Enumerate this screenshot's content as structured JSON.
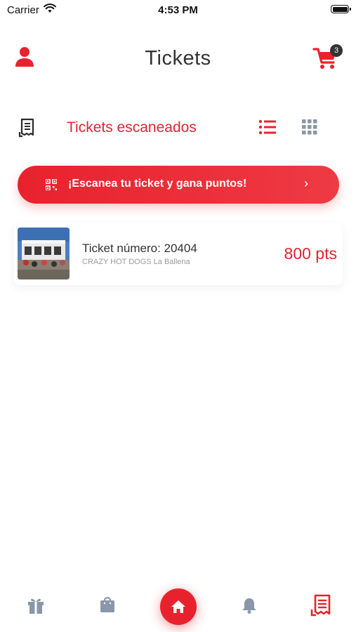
{
  "status_bar": {
    "carrier": "Carrier",
    "time": "4:53 PM"
  },
  "header": {
    "title": "Tickets",
    "cart_count": "3"
  },
  "section": {
    "title": "Tickets escaneados"
  },
  "scan_banner": {
    "label": "¡Escanea tu ticket y gana puntos!"
  },
  "tickets": [
    {
      "number": "Ticket número: 20404",
      "shop": "CRAZY HOT DOGS La Ballena",
      "points": "800 pts"
    }
  ],
  "colors": {
    "accent": "#e8222d",
    "text": "#333333",
    "muted": "#9a9a9a",
    "icon_gray": "#8a97a8"
  },
  "icons": [
    "profile-icon",
    "cart-icon",
    "receipt-icon",
    "list-icon",
    "grid-icon",
    "qr-icon",
    "chevron-right-icon",
    "gift-icon",
    "shopping-bag-icon",
    "home-icon",
    "bell-icon",
    "receipt-icon"
  ]
}
